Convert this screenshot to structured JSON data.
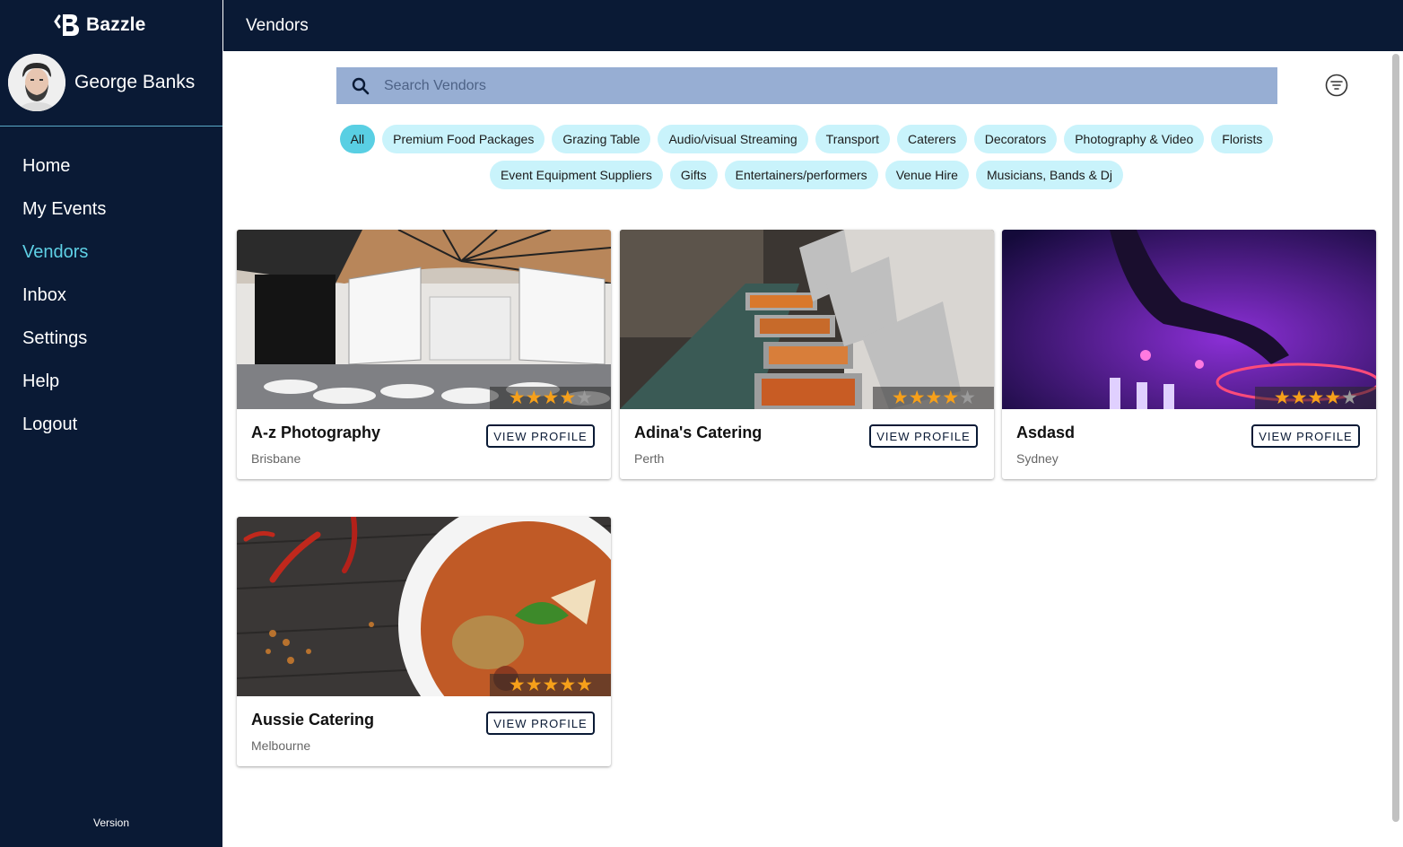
{
  "app": {
    "name": "Bazzle"
  },
  "user": {
    "name": "George Banks"
  },
  "nav": {
    "items": [
      {
        "label": "Home",
        "active": false
      },
      {
        "label": "My Events",
        "active": false
      },
      {
        "label": "Vendors",
        "active": true
      },
      {
        "label": "Inbox",
        "active": false
      },
      {
        "label": "Settings",
        "active": false
      },
      {
        "label": "Help",
        "active": false
      },
      {
        "label": "Logout",
        "active": false
      }
    ],
    "version_label": "Version"
  },
  "header": {
    "title": "Vendors"
  },
  "search": {
    "placeholder": "Search Vendors",
    "value": "",
    "icon": "search-icon"
  },
  "filter": {
    "icon": "filter-icon"
  },
  "categories": {
    "row1": [
      "All",
      "Premium Food Packages",
      "Grazing Table",
      "Audio/visual Streaming",
      "Transport",
      "Caterers",
      "Decorators",
      "Photography & Video",
      "Florists"
    ],
    "row2": [
      "Event Equipment Suppliers",
      "Gifts",
      "Entertainers/performers",
      "Venue Hire",
      "Musicians, Bands & Dj"
    ],
    "selected": "All"
  },
  "vendors": [
    {
      "name": "A-z Photography",
      "city": "Brisbane",
      "rating": 4,
      "button": "VIEW PROFILE",
      "image": "conference-hall"
    },
    {
      "name": "Adina's Catering",
      "city": "Perth",
      "rating": 4,
      "button": "VIEW PROFILE",
      "image": "buffet-trays"
    },
    {
      "name": "Asdasd",
      "city": "Sydney",
      "rating": 4,
      "button": "VIEW PROFILE",
      "image": "dj-turntable"
    },
    {
      "name": "Aussie Catering",
      "city": "Melbourne",
      "rating": 5,
      "button": "VIEW PROFILE",
      "image": "curry-bowl"
    }
  ],
  "colors": {
    "sidebar": "#0a1a35",
    "accent": "#5fd1e6",
    "chip": "#c9f3fb",
    "chip_selected": "#59cfe3",
    "star": "#f6a01a",
    "search_bg": "#97aed3"
  }
}
